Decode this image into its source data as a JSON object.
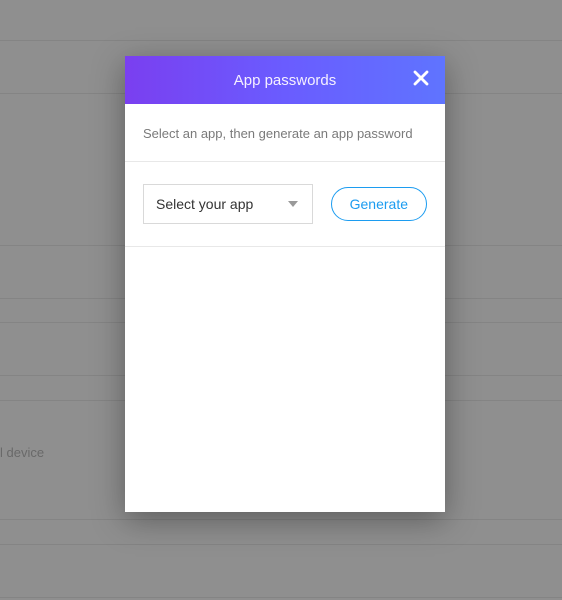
{
  "modal": {
    "title": "App passwords",
    "instruction": "Select an app, then generate an app password",
    "select": {
      "value": "Select your app"
    },
    "generate_label": "Generate"
  },
  "background": {
    "device_text": "l device"
  }
}
